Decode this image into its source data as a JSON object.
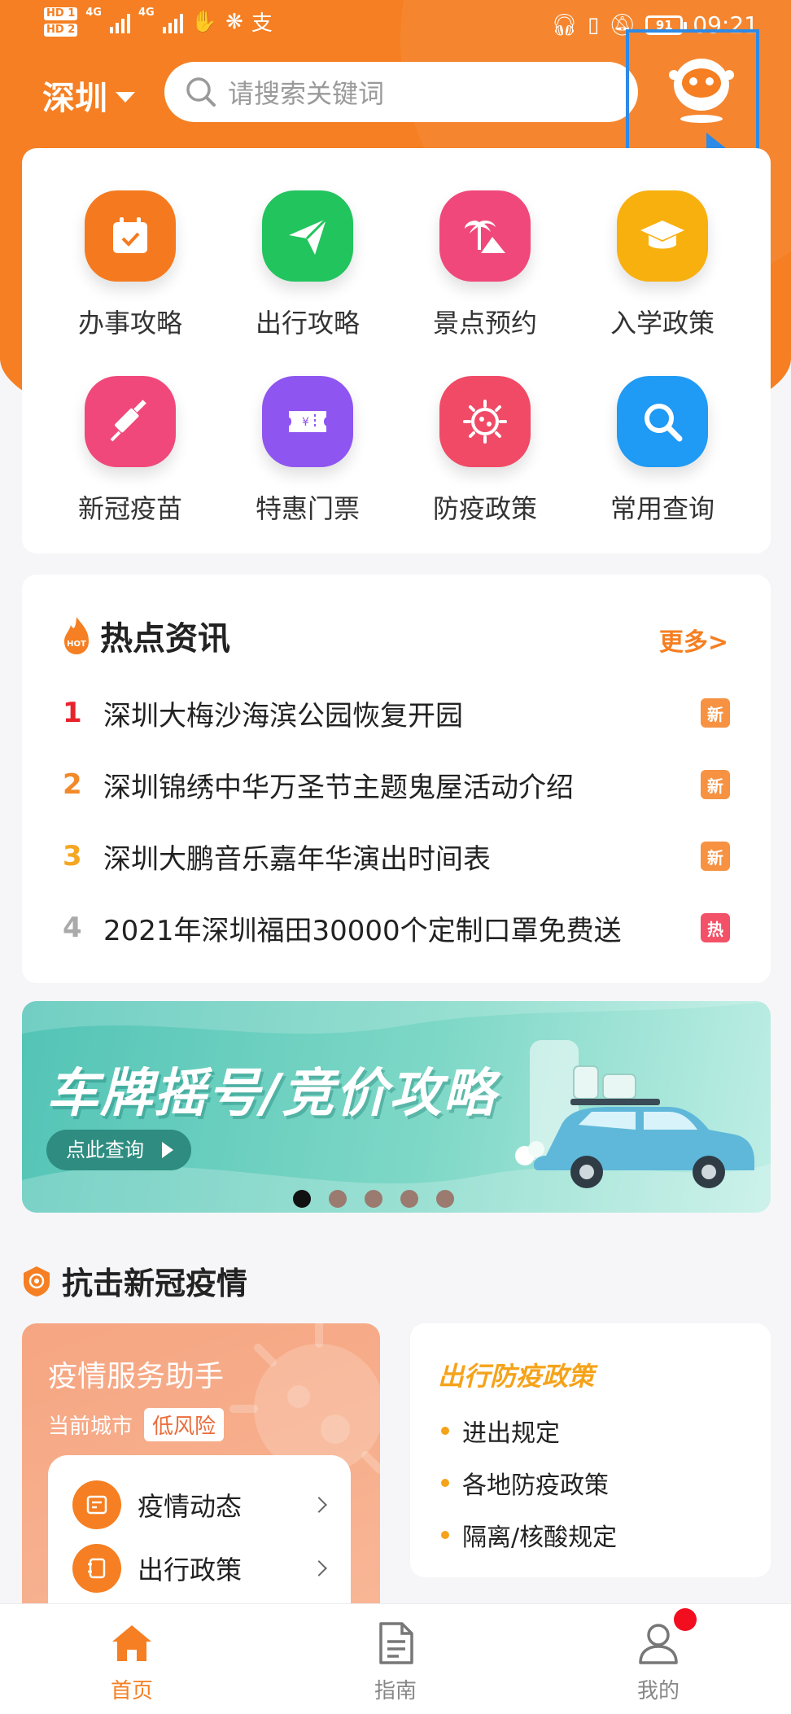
{
  "status_bar": {
    "sim1": "HD 1",
    "sim2": "HD 2",
    "net1": "4G",
    "net2": "4G",
    "battery": "91",
    "time": "09:21"
  },
  "header": {
    "city": "深圳",
    "search_placeholder": "请搜索关键词"
  },
  "services": [
    {
      "label": "办事攻略",
      "icon": "calendar-check-icon",
      "color": "#f57a1f"
    },
    {
      "label": "出行攻略",
      "icon": "paper-plane-icon",
      "color": "#22c45e"
    },
    {
      "label": "景点预约",
      "icon": "palm-mountain-icon",
      "color": "#f0487a"
    },
    {
      "label": "入学政策",
      "icon": "graduation-cap-icon",
      "color": "#f8b00f"
    },
    {
      "label": "新冠疫苗",
      "icon": "syringe-icon",
      "color": "#f0487a"
    },
    {
      "label": "特惠门票",
      "icon": "ticket-icon",
      "color": "#8e55f0"
    },
    {
      "label": "防疫政策",
      "icon": "virus-icon",
      "color": "#f04a66"
    },
    {
      "label": "常用查询",
      "icon": "search-icon",
      "color": "#1f9af5"
    }
  ],
  "hot_news": {
    "badge": "HOT",
    "title": "热点资讯",
    "more": "更多>",
    "items": [
      {
        "rank": "1",
        "text": "深圳大梅沙海滨公园恢复开园",
        "tag": "新",
        "rank_color": "#e8222b",
        "tag_color": "#f57f22"
      },
      {
        "rank": "2",
        "text": "深圳锦绣中华万圣节主题鬼屋活动介绍",
        "tag": "新",
        "rank_color": "#f28a2a",
        "tag_color": "#f57f22"
      },
      {
        "rank": "3",
        "text": "深圳大鹏音乐嘉年华演出时间表",
        "tag": "新",
        "rank_color": "#f5a623",
        "tag_color": "#f57f22"
      },
      {
        "rank": "4",
        "text": "2021年深圳福田30000个定制口罩免费送",
        "tag": "热",
        "rank_color": "#aaaaaa",
        "tag_color": "#f0334d"
      }
    ]
  },
  "banner": {
    "title": "车牌摇号/竞价攻略",
    "button": "点此查询",
    "slides": 5,
    "active_slide": 1
  },
  "covid": {
    "title": "抗击新冠疫情",
    "assistant": {
      "title": "疫情服务助手",
      "city_label": "当前城市",
      "risk": "低风险",
      "items": [
        {
          "label": "疫情动态",
          "icon": "news-icon"
        },
        {
          "label": "出行政策",
          "icon": "notebook-icon"
        }
      ]
    },
    "policy": {
      "title": "出行防疫政策",
      "items": [
        "进出规定",
        "各地防疫政策",
        "隔离/核酸规定"
      ]
    }
  },
  "tabbar": {
    "items": [
      {
        "label": "首页",
        "icon": "home-icon",
        "active": true
      },
      {
        "label": "指南",
        "icon": "document-icon",
        "active": false
      },
      {
        "label": "我的",
        "icon": "user-icon",
        "active": false
      }
    ]
  },
  "colors": {
    "brand": "#f57f22",
    "highlight_box": "#2d8ae6",
    "notification_dot": "#f20d1f"
  }
}
